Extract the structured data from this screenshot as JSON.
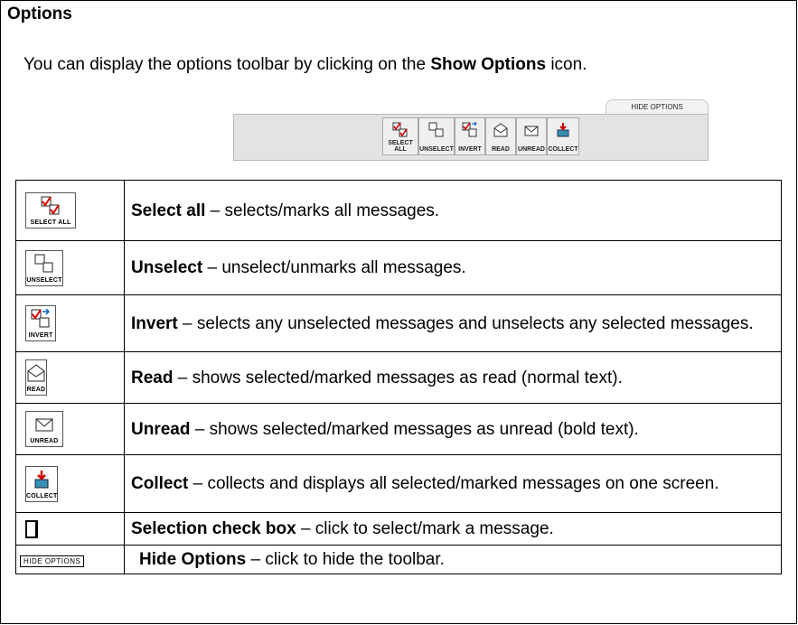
{
  "section": {
    "title": "Options"
  },
  "intro": {
    "prefix": "You can display the options toolbar by clicking on the ",
    "bold": "Show Options",
    "suffix": " icon."
  },
  "toolbar": {
    "hide_tab_label": "HIDE OPTIONS",
    "buttons": [
      {
        "label": "SELECT ALL",
        "icon": "select-all-icon"
      },
      {
        "label": "UNSELECT",
        "icon": "unselect-icon"
      },
      {
        "label": "INVERT",
        "icon": "invert-icon"
      },
      {
        "label": "READ",
        "icon": "read-icon"
      },
      {
        "label": "UNREAD",
        "icon": "unread-icon"
      },
      {
        "label": "COLLECT",
        "icon": "collect-icon"
      }
    ]
  },
  "options": [
    {
      "icon_label": "SELECT ALL",
      "name": "Select all",
      "text": " – selects/marks all messages."
    },
    {
      "icon_label": "UNSELECT",
      "name": "Unselect",
      "text": " – unselect/unmarks all messages."
    },
    {
      "icon_label": "INVERT",
      "name": "Invert",
      "text": " – selects any unselected messages and unselects any selected messages."
    },
    {
      "icon_label": "READ",
      "name": "Read",
      "text": " – shows selected/marked messages as read (normal text)."
    },
    {
      "icon_label": "UNREAD",
      "name": "Unread",
      "text": " – shows selected/marked messages as unread (bold text)."
    },
    {
      "icon_label": "COLLECT",
      "name": "Collect",
      "text": " – collects and displays all selected/marked messages on one screen."
    },
    {
      "icon_label": "",
      "name": "Selection check box",
      "text": " – click to select/mark a message."
    },
    {
      "icon_label": "HIDE OPTIONS",
      "name": "Hide Options",
      "text": " – click to hide the toolbar."
    }
  ]
}
